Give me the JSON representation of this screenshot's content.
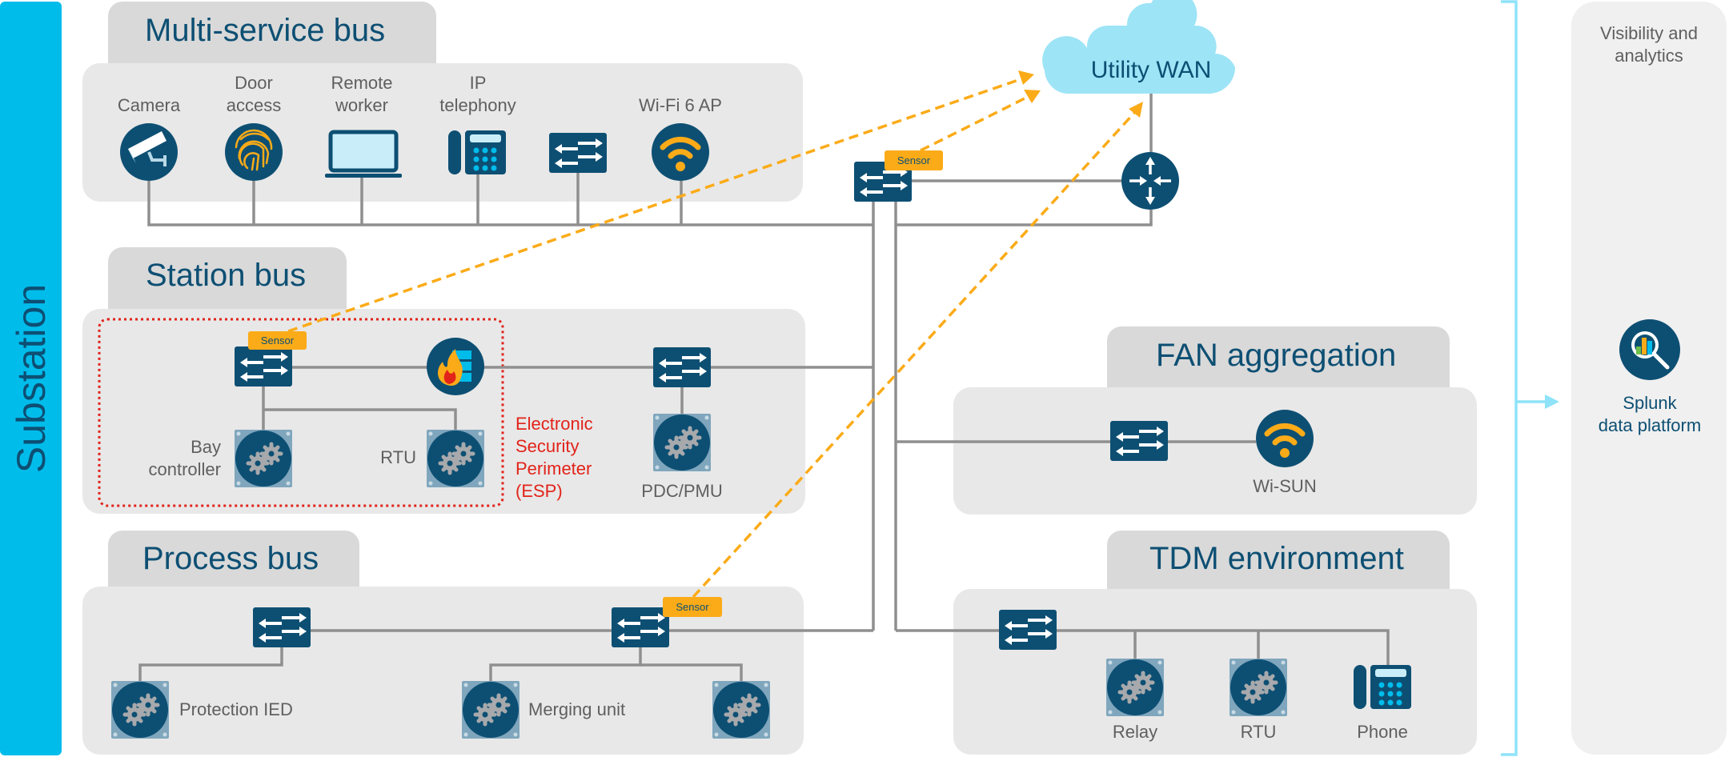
{
  "side_label": "Substation",
  "colors": {
    "device_blue": "#0d4f73",
    "accent_cyan": "#00bceb",
    "cloud": "#9de4f6",
    "sensor": "#fbab18",
    "esp_red": "#e2231a",
    "line_gray": "#8f8f8f",
    "box_gray": "#e8e8e8",
    "tab_gray": "#d9d9d9"
  },
  "multi_service_bus": {
    "title": "Multi-service bus",
    "devices": [
      {
        "label_line1": "",
        "label_line2": "Camera",
        "icon": "camera-icon"
      },
      {
        "label_line1": "Door",
        "label_line2": "access",
        "icon": "fingerprint-icon"
      },
      {
        "label_line1": "Remote",
        "label_line2": "worker",
        "icon": "laptop-icon"
      },
      {
        "label_line1": "IP",
        "label_line2": "telephony",
        "icon": "ip-phone-icon"
      },
      {
        "label_line1": "",
        "label_line2": "",
        "icon": "switch-icon"
      },
      {
        "label_line1": "",
        "label_line2": "Wi-Fi 6 AP",
        "icon": "wifi-icon"
      }
    ]
  },
  "core": {
    "sensor_label": "Sensor",
    "router_icon": "router-icon",
    "switch_icon": "switch-icon"
  },
  "wan": {
    "label": "Utility WAN"
  },
  "station_bus": {
    "title": "Station bus",
    "sensor_label": "Sensor",
    "bay_controller_line1": "Bay",
    "bay_controller_line2": "controller",
    "rtu_label": "RTU",
    "pdc_label": "PDC/PMU",
    "esp_lines": [
      "Electronic",
      "Security",
      "Perimeter",
      "(ESP)"
    ]
  },
  "process_bus": {
    "title": "Process bus",
    "sensor_label": "Sensor",
    "protection_label": "Protection IED",
    "merging_label": "Merging unit"
  },
  "fan_aggregation": {
    "title": "FAN aggregation",
    "wisun_label": "Wi-SUN"
  },
  "tdm": {
    "title": "TDM environment",
    "relay_label": "Relay",
    "rtu_label": "RTU",
    "phone_label": "Phone"
  },
  "visibility": {
    "title_line1": "Visibility and",
    "title_line2": "analytics",
    "splunk_line1": "Splunk",
    "splunk_line2": "data platform"
  }
}
